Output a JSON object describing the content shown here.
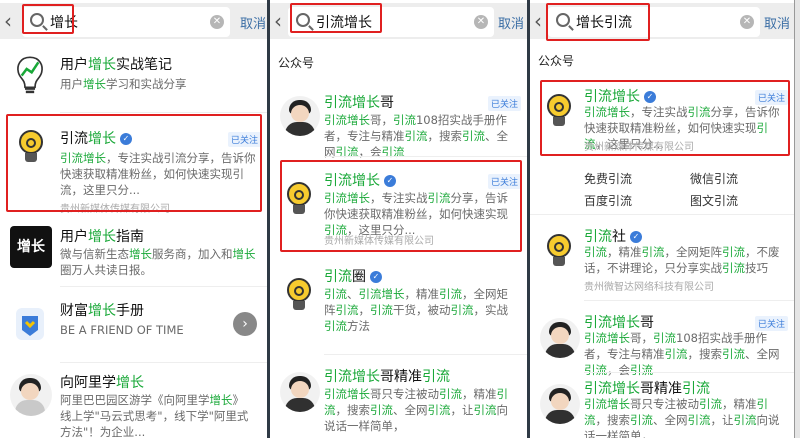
{
  "panels": [
    {
      "search": {
        "query": "增长",
        "cancel": "取消"
      },
      "results": [
        {
          "title_pre": "用户",
          "title_g": "增长",
          "title_post": "实战笔记",
          "desc": [
            {
              "t": "用户"
            },
            {
              "t": "增长",
              "g": true
            },
            {
              "t": "学习和实战分享"
            }
          ]
        },
        {
          "title_pre": "引流",
          "title_g": "增长",
          "title_post": "",
          "verified": true,
          "tag": "已关注",
          "desc": [
            {
              "t": "引流",
              "g": true
            },
            {
              "t": "增长",
              "g": true
            },
            {
              "t": "，专注实战引流分享，告诉你快速获取精准粉丝，如何快速实现引流，这里只分..."
            }
          ],
          "org": "贵州新媒体传媒有限公司"
        },
        {
          "title_pre": "用户",
          "title_g": "增长",
          "title_post": "指南",
          "logo_text": "增长",
          "desc": [
            {
              "t": "微与信新生态"
            },
            {
              "t": "增长",
              "g": true
            },
            {
              "t": "服务商，加入和"
            },
            {
              "t": "增长",
              "g": true
            },
            {
              "t": "圈万人共读日报。"
            }
          ]
        },
        {
          "title_pre": "财富",
          "title_g": "增长",
          "title_post": "手册",
          "desc": [
            {
              "t": "BE A FRIEND OF TIME"
            }
          ]
        },
        {
          "title_pre": "向阿里学",
          "title_g": "增长",
          "title_post": "",
          "desc": [
            {
              "t": "阿里巴巴园区游学《向阿里学"
            },
            {
              "t": "增长",
              "g": true
            },
            {
              "t": "》 线上学\"马云式思考\"，线下学\"阿里式方法\"！为企业..."
            }
          ]
        }
      ]
    },
    {
      "search": {
        "query": "引流增长",
        "cancel": "取消"
      },
      "section": "公众号",
      "results": [
        {
          "title_pre": "",
          "title_g": "引流增长",
          "title_post": "哥",
          "tag": "已关注",
          "desc": [
            {
              "t": "引流增长",
              "g": true
            },
            {
              "t": "哥，"
            },
            {
              "t": "引流",
              "g": true
            },
            {
              "t": "108招实战手册作者，专注与精准"
            },
            {
              "t": "引流",
              "g": true
            },
            {
              "t": "，搜索"
            },
            {
              "t": "引流",
              "g": true
            },
            {
              "t": "、全网"
            },
            {
              "t": "引流",
              "g": true
            },
            {
              "t": "，会"
            },
            {
              "t": "引流",
              "g": true
            }
          ]
        },
        {
          "title_pre": "",
          "title_g": "引流增长",
          "title_post": "",
          "verified": true,
          "tag": "已关注",
          "desc": [
            {
              "t": "引流增长",
              "g": true
            },
            {
              "t": "，专注实战"
            },
            {
              "t": "引流",
              "g": true
            },
            {
              "t": "分享，告诉你快速获取精准粉丝，如何快速实现"
            },
            {
              "t": "引流",
              "g": true
            },
            {
              "t": "，这里只分..."
            }
          ],
          "org": "贵州新媒体传媒有限公司"
        },
        {
          "title_pre": "",
          "title_g": "引流",
          "title_post": "圈",
          "verified": true,
          "desc": [
            {
              "t": "引流",
              "g": true
            },
            {
              "t": "、"
            },
            {
              "t": "引流增长",
              "g": true
            },
            {
              "t": "，精准"
            },
            {
              "t": "引流",
              "g": true
            },
            {
              "t": "，全网矩阵"
            },
            {
              "t": "引流",
              "g": true
            },
            {
              "t": "，"
            },
            {
              "t": "引流",
              "g": true
            },
            {
              "t": "干货，被动"
            },
            {
              "t": "引流",
              "g": true
            },
            {
              "t": "，实战"
            },
            {
              "t": "引流",
              "g": true
            },
            {
              "t": "方法"
            }
          ]
        },
        {
          "title_pre": "",
          "title_g": "引流增长",
          "title_post": "哥精准",
          "title_g2": "引流",
          "desc": [
            {
              "t": "引流增长",
              "g": true
            },
            {
              "t": "哥只专注被动"
            },
            {
              "t": "引流",
              "g": true
            },
            {
              "t": "，精准"
            },
            {
              "t": "引流",
              "g": true
            },
            {
              "t": "，搜索"
            },
            {
              "t": "引流",
              "g": true
            },
            {
              "t": "、全网"
            },
            {
              "t": "引流",
              "g": true
            },
            {
              "t": "，让"
            },
            {
              "t": "引流",
              "g": true
            },
            {
              "t": "向说话一样简单，"
            }
          ]
        }
      ]
    },
    {
      "search": {
        "query": "增长引流",
        "cancel": "取消"
      },
      "section": "公众号",
      "results": [
        {
          "title_pre": "",
          "title_g": "引流增长",
          "title_post": "",
          "verified": true,
          "tag": "已关注",
          "desc": [
            {
              "t": "引流增长",
              "g": true
            },
            {
              "t": "，专注实战"
            },
            {
              "t": "引流",
              "g": true
            },
            {
              "t": "分享，告诉你快速获取精准粉丝，如何快速实现"
            },
            {
              "t": "引流",
              "g": true
            },
            {
              "t": "，这里只分..."
            }
          ],
          "org": "贵州新媒体传媒有限公司"
        },
        {
          "title_pre": "",
          "title_g": "引流",
          "title_post": "社",
          "verified": true,
          "desc": [
            {
              "t": "引流",
              "g": true
            },
            {
              "t": "，精准"
            },
            {
              "t": "引流",
              "g": true
            },
            {
              "t": "，全网矩阵"
            },
            {
              "t": "引流",
              "g": true
            },
            {
              "t": "，不废话，不讲理论，只分享实战"
            },
            {
              "t": "引流",
              "g": true
            },
            {
              "t": "技巧"
            }
          ],
          "org": "贵州微智达网络科技有限公司"
        },
        {
          "title_pre": "",
          "title_g": "引流增长",
          "title_post": "哥",
          "tag": "已关注",
          "desc": [
            {
              "t": "引流增长",
              "g": true
            },
            {
              "t": "哥，"
            },
            {
              "t": "引流",
              "g": true
            },
            {
              "t": "108招实战手册作者，专注与精准"
            },
            {
              "t": "引流",
              "g": true
            },
            {
              "t": "，搜索"
            },
            {
              "t": "引流",
              "g": true
            },
            {
              "t": "、全网"
            },
            {
              "t": "引流",
              "g": true
            },
            {
              "t": "，会"
            },
            {
              "t": "引流",
              "g": true
            }
          ]
        },
        {
          "title_pre": "",
          "title_g": "引流增长",
          "title_post": "哥精准",
          "title_g2": "引流",
          "desc": [
            {
              "t": "引流增长",
              "g": true
            },
            {
              "t": "哥只专注被动"
            },
            {
              "t": "引流",
              "g": true
            },
            {
              "t": "，精准"
            },
            {
              "t": "引流",
              "g": true
            },
            {
              "t": "，搜索"
            },
            {
              "t": "引流",
              "g": true
            },
            {
              "t": "、全网"
            },
            {
              "t": "引流",
              "g": true
            },
            {
              "t": "，让"
            },
            {
              "t": "引流",
              "g": true
            },
            {
              "t": "向说话一样简单，"
            }
          ]
        }
      ],
      "related": [
        "免费引流",
        "微信引流",
        "百度引流",
        "图文引流"
      ]
    }
  ],
  "colors": {
    "highlight": "#19a838",
    "annotation": "#e02020",
    "verified": "#3b7cd9"
  }
}
